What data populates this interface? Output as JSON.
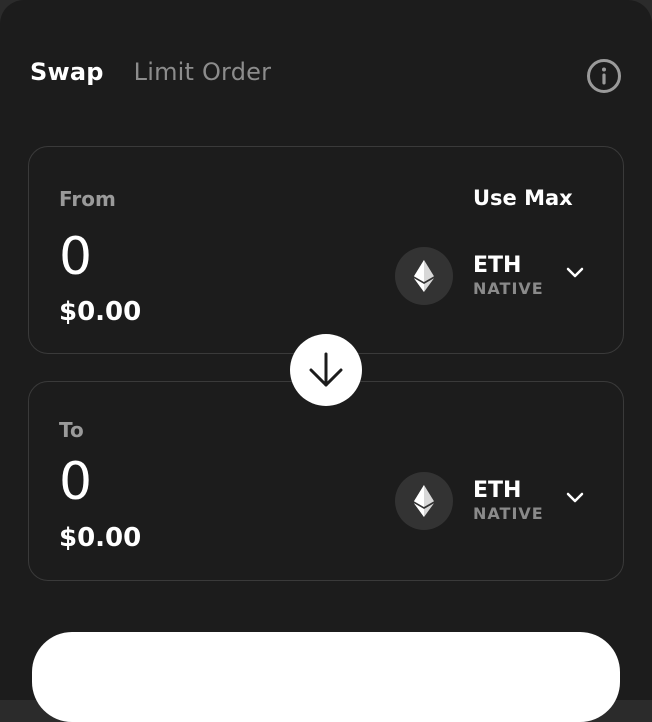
{
  "tabs": [
    {
      "label": "Swap",
      "active": true
    },
    {
      "label": "Limit Order",
      "active": false
    }
  ],
  "header": {
    "info_icon": "info-circle-icon"
  },
  "from": {
    "label": "From",
    "amount": "0",
    "usd": "$0.00",
    "use_max": "Use Max",
    "token": {
      "symbol": "ETH",
      "type": "NATIVE",
      "icon": "ethereum-icon"
    }
  },
  "to": {
    "label": "To",
    "amount": "0",
    "usd": "$0.00",
    "token": {
      "symbol": "ETH",
      "type": "NATIVE",
      "icon": "ethereum-icon"
    }
  },
  "swap_direction_icon": "arrow-down-icon",
  "colors": {
    "background": "#1c1c1c",
    "card_border": "#3a3a3a",
    "muted_text": "#9a9a9a",
    "accent": "#ffffff"
  }
}
